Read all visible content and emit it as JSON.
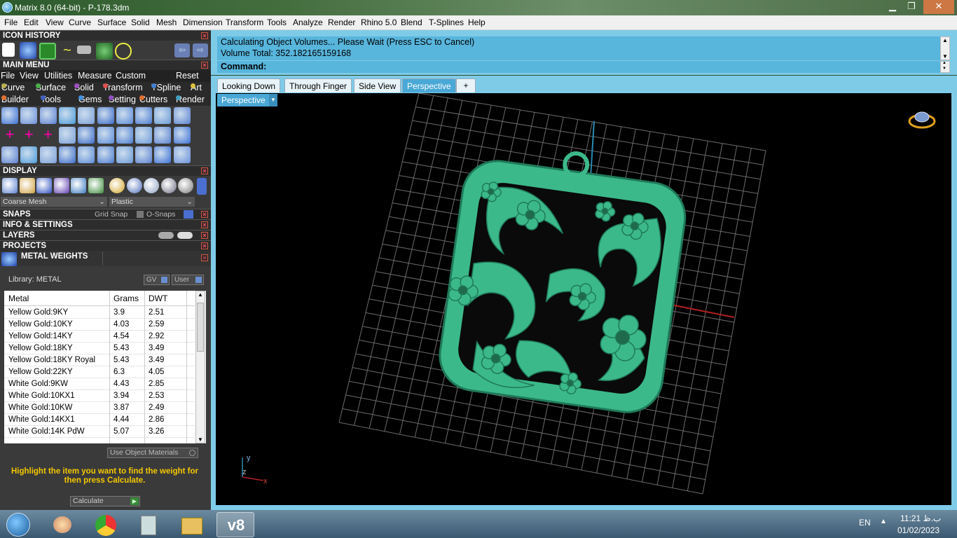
{
  "window": {
    "title": "Matrix 8.0 (64-bit) - P-178.3dm",
    "minimize": "▁",
    "maximize": "❐",
    "close": "✕"
  },
  "menubar": [
    "File",
    "Edit",
    "View",
    "Curve",
    "Surface",
    "Solid",
    "Mesh",
    "Dimension",
    "Transform",
    "Tools",
    "Analyze",
    "Render",
    "Rhino 5.0",
    "Blend",
    "T-Splines",
    "Help"
  ],
  "left": {
    "icon_history": "ICON HISTORY",
    "main_menu": "MAIN MENU",
    "main_menu_items": [
      "File",
      "View",
      "Utilities",
      "Measure",
      "Custom"
    ],
    "reset": "Reset",
    "cat_row1": [
      {
        "label": "Curve",
        "color": "#b8b050"
      },
      {
        "label": "Surface",
        "color": "#4ab04a"
      },
      {
        "label": "Solid",
        "color": "#a050c0"
      },
      {
        "label": "Transform",
        "color": "#e05050"
      },
      {
        "label": "TSpline",
        "color": "#4080d0"
      },
      {
        "label": "Art",
        "color": "#e0c040"
      }
    ],
    "cat_row2": [
      {
        "label": "Builder",
        "color": "#e07030"
      },
      {
        "label": "Tools",
        "color": "#4060c0"
      },
      {
        "label": "Gems",
        "color": "#4090e0"
      },
      {
        "label": "Setting",
        "color": "#9050c0"
      },
      {
        "label": "Cutters",
        "color": "#e07030"
      },
      {
        "label": "Render",
        "color": "#40a0c0"
      }
    ],
    "display": "DISPLAY",
    "display_mode": "Coarse Mesh",
    "material": "Plastic",
    "snaps": "SNAPS",
    "grid_snap": "Grid Snap",
    "osnaps": "O-Snaps",
    "info_settings": "INFO & SETTINGS",
    "layers": "LAYERS",
    "projects": "PROJECTS",
    "metal_weights": "METAL WEIGHTS",
    "library": "Library: METAL",
    "gv": "GV",
    "user": "User",
    "columns": [
      "Metal",
      "Grams",
      "DWT"
    ],
    "rows": [
      [
        "Yellow Gold:9KY",
        "3.9",
        "2.51"
      ],
      [
        "Yellow Gold:10KY",
        "4.03",
        "2.59"
      ],
      [
        "Yellow Gold:14KY",
        "4.54",
        "2.92"
      ],
      [
        "Yellow Gold:18KY",
        "5.43",
        "3.49"
      ],
      [
        "Yellow Gold:18KY Royal",
        "5.43",
        "3.49"
      ],
      [
        "Yellow Gold:22KY",
        "6.3",
        "4.05"
      ],
      [
        "White Gold:9KW",
        "4.43",
        "2.85"
      ],
      [
        "White Gold:10KX1",
        "3.94",
        "2.53"
      ],
      [
        "White Gold:10KW",
        "3.87",
        "2.49"
      ],
      [
        "White Gold:14KX1",
        "4.44",
        "2.86"
      ],
      [
        "White Gold:14K PdW",
        "5.07",
        "3.26"
      ]
    ],
    "use_object_materials": "Use Object Materials",
    "hint": "Highlight the item you want to find the weight for then press Calculate.",
    "calculate": "Calculate"
  },
  "command": {
    "line1": "Calculating Object Volumes... Please Wait (Press ESC to Cancel)",
    "line2": "Volume Total: 352.182165159168",
    "prompt": "Command:"
  },
  "tabs": [
    "Looking Down",
    "Through Finger",
    "Side View",
    "Perspective"
  ],
  "tab_add": "+",
  "viewport": {
    "label": "Perspective",
    "axis_y": "y",
    "axis_z": "z",
    "axis_x": "x"
  },
  "taskbar": {
    "lang": "EN",
    "time": "11:21 ب.ظ",
    "date": "01/02/2023"
  }
}
